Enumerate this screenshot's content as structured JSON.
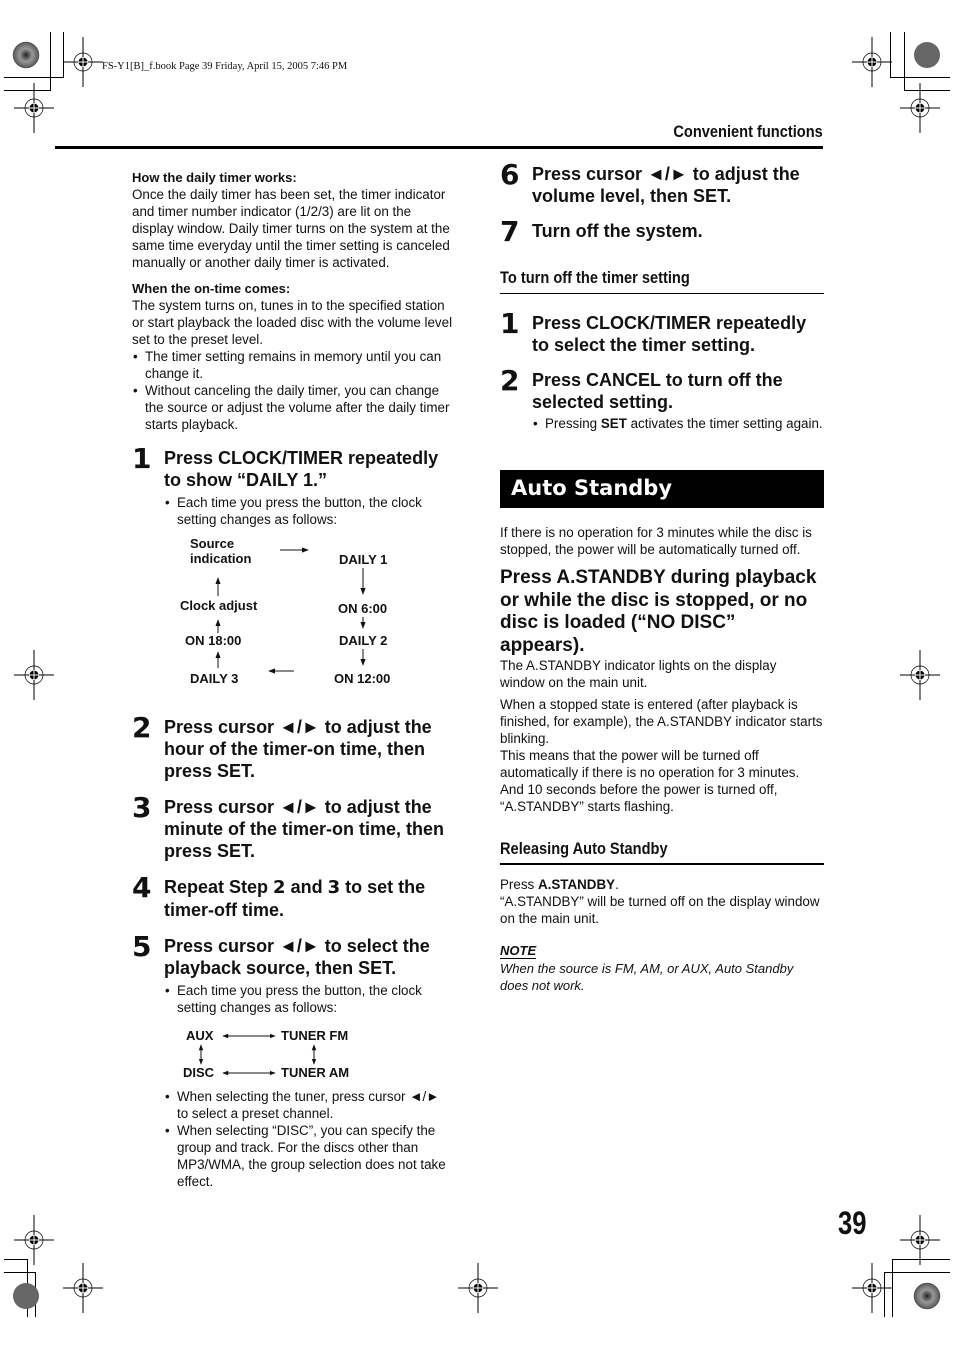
{
  "slug": "FS-Y1[B]_f.book  Page 39  Friday, April 15, 2005  7:46 PM",
  "header": {
    "section_title": "Convenient functions"
  },
  "page_number": "39",
  "left": {
    "how_works": {
      "heading": "How the daily timer works:",
      "text": "Once the daily timer has been set, the timer indicator and timer number indicator (1/2/3) are lit on the display window. Daily timer turns on the system at the same time everyday until the timer setting is canceled manually or another daily timer is activated."
    },
    "on_time": {
      "heading": "When the on-time comes:",
      "text": "The system turns on, tunes in to the specified station or start playback the loaded disc with the volume level set to the preset level.",
      "bullets": [
        "The timer setting remains in memory until you can change it.",
        "Without canceling the daily timer, you can change the source or adjust the volume after the daily timer starts playback."
      ]
    },
    "steps": [
      {
        "num": "1",
        "text": "Press CLOCK/TIMER repeatedly to show “DAILY 1.”",
        "bullet": "Each time you press the button, the clock setting changes as follows:"
      },
      {
        "num": "2",
        "text": "Press cursor ◄/► to adjust the hour of the timer-on time, then press SET."
      },
      {
        "num": "3",
        "text": "Press cursor ◄/► to adjust the minute of the timer-on time, then press SET."
      },
      {
        "num": "4",
        "text_a": "Repeat Step ",
        "b1": "2",
        "text_b": " and ",
        "b2": "3",
        "text_c": " to set the timer-off time."
      },
      {
        "num": "5",
        "text": "Press cursor ◄/► to select the playback source, then SET.",
        "bullet": "Each time you press the button, the clock setting changes as follows:"
      }
    ],
    "timer_cycle": {
      "source_indication_1": "Source",
      "source_indication_2": "indication",
      "daily1": "DAILY 1",
      "on600": "ON 6:00",
      "daily2": "DAILY 2",
      "on1200": "ON 12:00",
      "daily3": "DAILY 3",
      "on1800": "ON 18:00",
      "clock_adjust": "Clock adjust"
    },
    "source_cycle": {
      "aux": "AUX",
      "tuner_fm": "TUNER FM",
      "disc": "DISC",
      "tuner_am": "TUNER AM"
    },
    "step5_more_bullets": [
      "When selecting the tuner, press cursor ◄/► to select a preset channel.",
      "When selecting “DISC”, you can specify the group and track. For the discs other than MP3/WMA, the group selection does not take effect."
    ]
  },
  "right": {
    "steps_cont": [
      {
        "num": "6",
        "text": "Press cursor ◄/► to adjust the volume level, then SET."
      },
      {
        "num": "7",
        "text": "Turn off the system."
      }
    ],
    "turn_off": {
      "heading": "To turn off the timer setting",
      "steps": [
        {
          "num": "1",
          "text": "Press CLOCK/TIMER repeatedly to select the timer setting."
        },
        {
          "num": "2",
          "text": "Press CANCEL to turn off the selected setting.",
          "bullet_a": "Pressing ",
          "bullet_b": "SET",
          "bullet_c": " activates the timer setting again."
        }
      ]
    },
    "auto_standby": {
      "banner": "Auto Standby",
      "intro": "If there is no operation for 3 minutes while the disc is stopped, the power will be automatically turned off.",
      "instruction": "Press A.STANDBY during playback or while the disc is stopped, or no disc is loaded (“NO DISC” appears).",
      "p1": "The A.STANDBY indicator lights on the display window on the main unit.",
      "p2": "When a stopped state is entered (after playback is finished, for example), the A.STANDBY indicator starts blinking.",
      "p3": "This means that the power will be turned off automatically if there is no operation for 3 minutes.",
      "p4": "And 10 seconds before the power is turned off, “A.STANDBY” starts flashing."
    },
    "releasing": {
      "heading": "Releasing Auto Standby",
      "press_a": "Press ",
      "press_b": "A.STANDBY",
      "press_c": ".",
      "text": "“A.STANDBY” will be turned off on the display window on the main unit."
    },
    "note": {
      "heading": "NOTE",
      "text": "When the source is FM, AM, or AUX, Auto Standby does not work."
    }
  }
}
